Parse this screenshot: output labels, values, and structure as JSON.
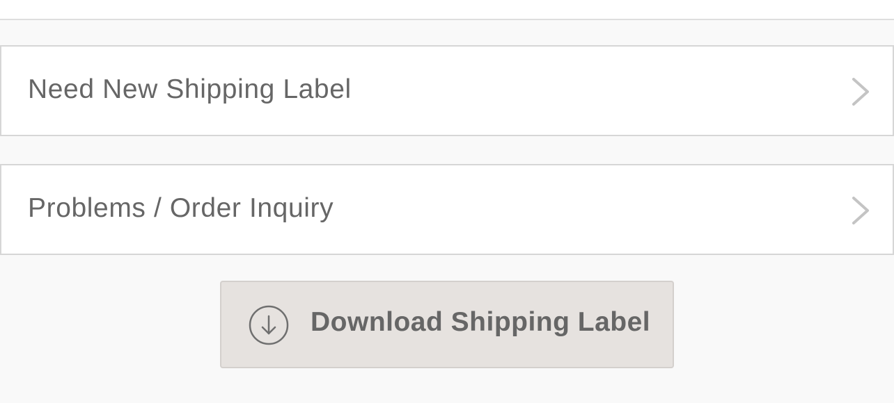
{
  "menu": {
    "items": [
      {
        "label": "Need New Shipping Label",
        "icon": "chevron-right-icon"
      },
      {
        "label": "Problems / Order Inquiry",
        "icon": "chevron-right-icon"
      }
    ]
  },
  "download": {
    "label": "Download Shipping Label",
    "icon": "download-arrow-icon"
  },
  "colors": {
    "background": "#f9f9f9",
    "row_background": "#ffffff",
    "border": "#d6d6d6",
    "text": "#666666",
    "chevron": "#c4c4c4",
    "button_background": "#e6e2df"
  }
}
